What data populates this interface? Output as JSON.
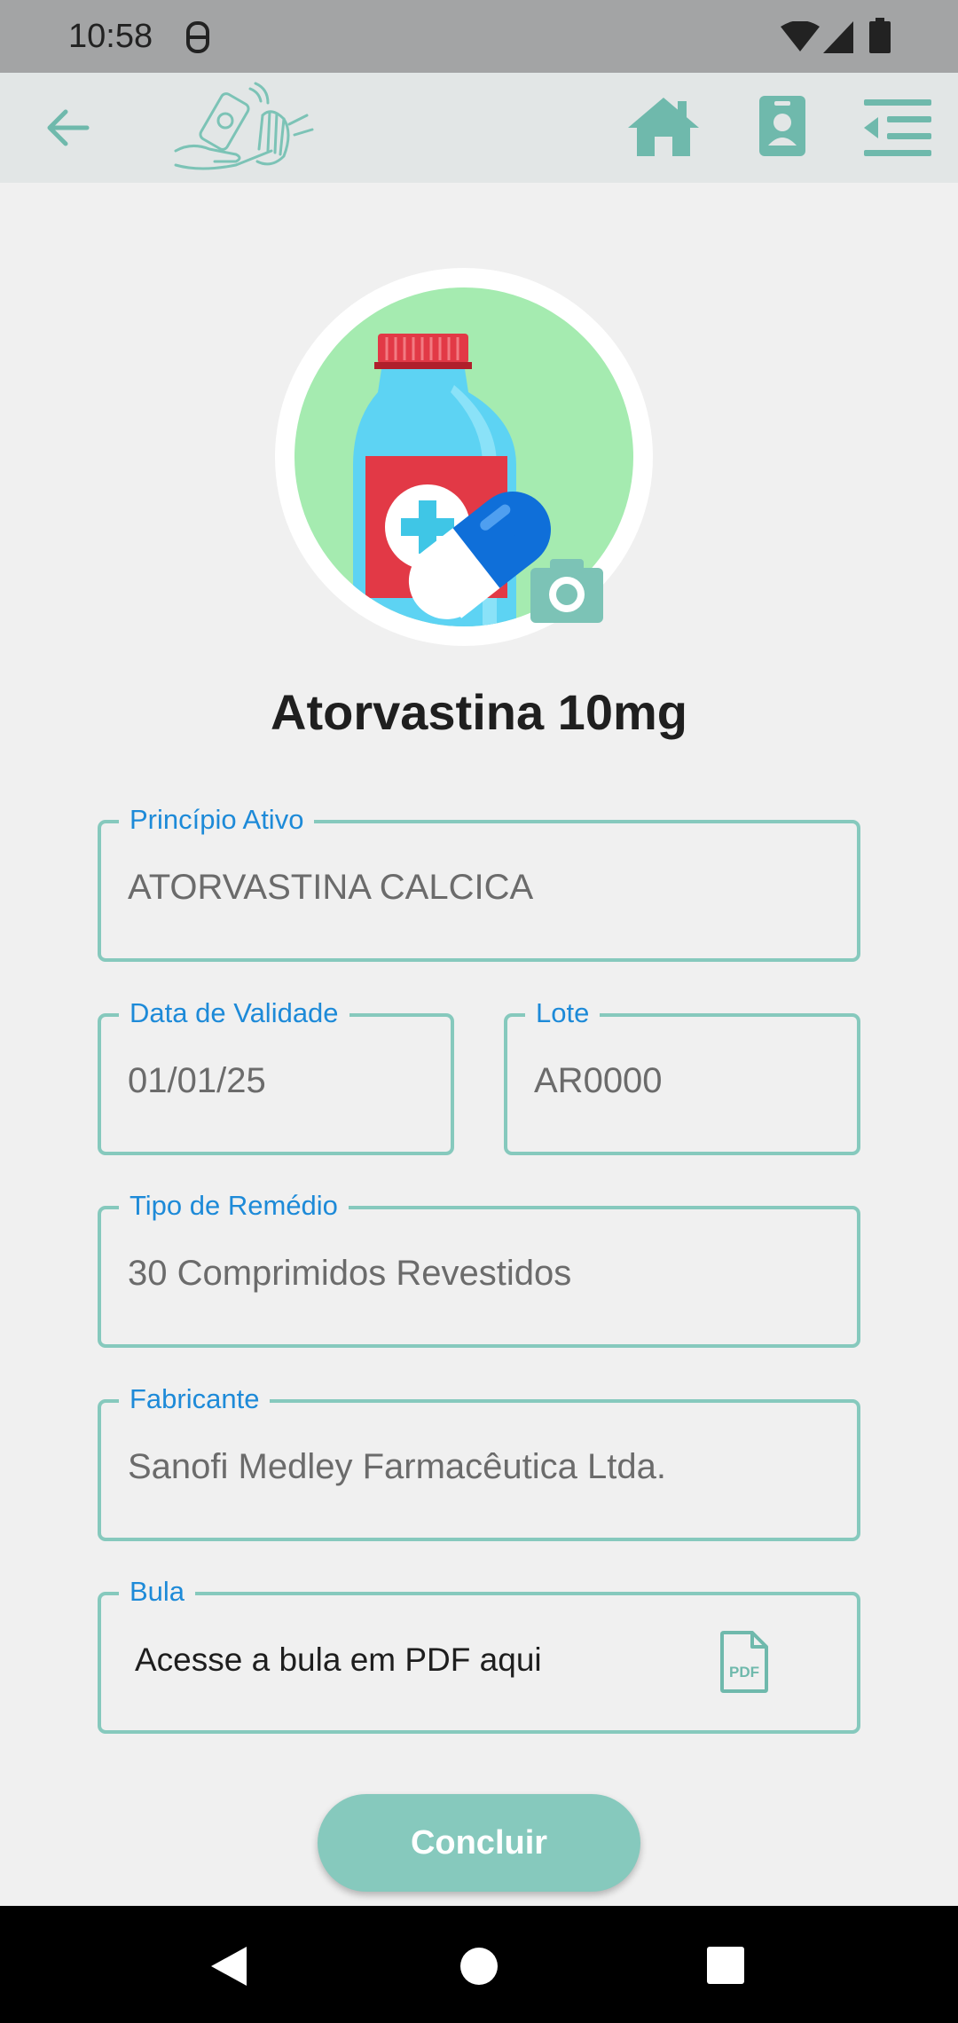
{
  "status_bar": {
    "time": "10:58"
  },
  "icons": {
    "back": "arrow-left-icon",
    "logo": "medicine-hands-logo",
    "home": "home-icon",
    "profile": "id-card-icon",
    "menu": "menu-icon",
    "camera": "camera-icon",
    "pdf": "pdf-file-icon"
  },
  "colors": {
    "accent": "#86c9bd",
    "label": "#1d8ad8",
    "app_bar": "#e2e6e6"
  },
  "medicine": {
    "title": "Atorvastina 10mg"
  },
  "fields": {
    "principio_ativo": {
      "label": "Princípio Ativo",
      "value": "ATORVASTINA CALCICA"
    },
    "data_validade": {
      "label": "Data de Validade",
      "value": "01/01/25"
    },
    "lote": {
      "label": "Lote",
      "value": "AR0000"
    },
    "tipo_remedio": {
      "label": "Tipo de Remédio",
      "value": "30 Comprimidos Revestidos"
    },
    "fabricante": {
      "label": "Fabricante",
      "value": "Sanofi Medley Farmacêutica Ltda."
    },
    "bula": {
      "label": "Bula",
      "link_text": "Acesse a bula em PDF aqui"
    }
  },
  "actions": {
    "concluir_label": "Concluir"
  }
}
